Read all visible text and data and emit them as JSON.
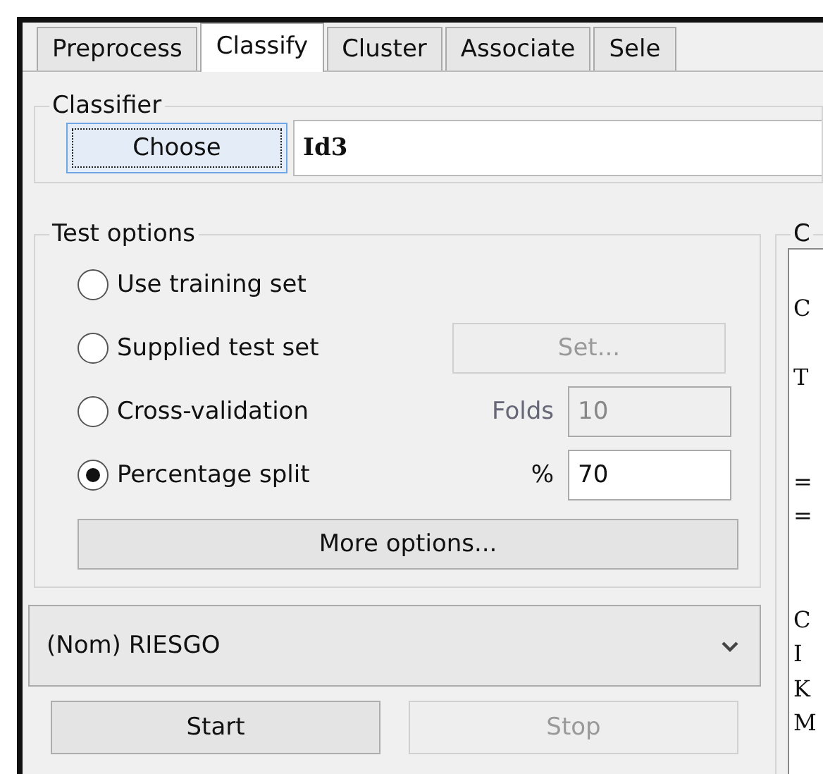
{
  "tabs": [
    {
      "label": "Preprocess",
      "selected": false
    },
    {
      "label": "Classify",
      "selected": true
    },
    {
      "label": "Cluster",
      "selected": false
    },
    {
      "label": "Associate",
      "selected": false
    },
    {
      "label": "Sele",
      "selected": false
    }
  ],
  "classifier": {
    "legend": "Classifier",
    "choose_button": "Choose",
    "value": "Id3"
  },
  "test_options": {
    "legend": "Test options",
    "options": [
      {
        "kind": "plain",
        "label": "Use training set",
        "selected": false
      },
      {
        "kind": "button",
        "label": "Supplied test set",
        "selected": false,
        "button": "Set...",
        "disabled": true
      },
      {
        "kind": "field",
        "label": "Cross-validation",
        "selected": false,
        "field_label": "Folds",
        "value": "10",
        "disabled": true
      },
      {
        "kind": "field",
        "label": "Percentage split",
        "selected": true,
        "field_label": "%",
        "value": "70",
        "disabled": false
      }
    ],
    "more_button": "More options..."
  },
  "class_attribute": {
    "value": "(Nom) RIESGO"
  },
  "start_button": {
    "label": "Start",
    "disabled": false
  },
  "stop_button": {
    "label": "Stop",
    "disabled": true
  },
  "output": {
    "legend": "C",
    "blocks": [
      [
        "C"
      ],
      [
        "T"
      ],
      [
        "=",
        "="
      ],
      [
        "C",
        "I",
        "K",
        "M"
      ]
    ]
  }
}
